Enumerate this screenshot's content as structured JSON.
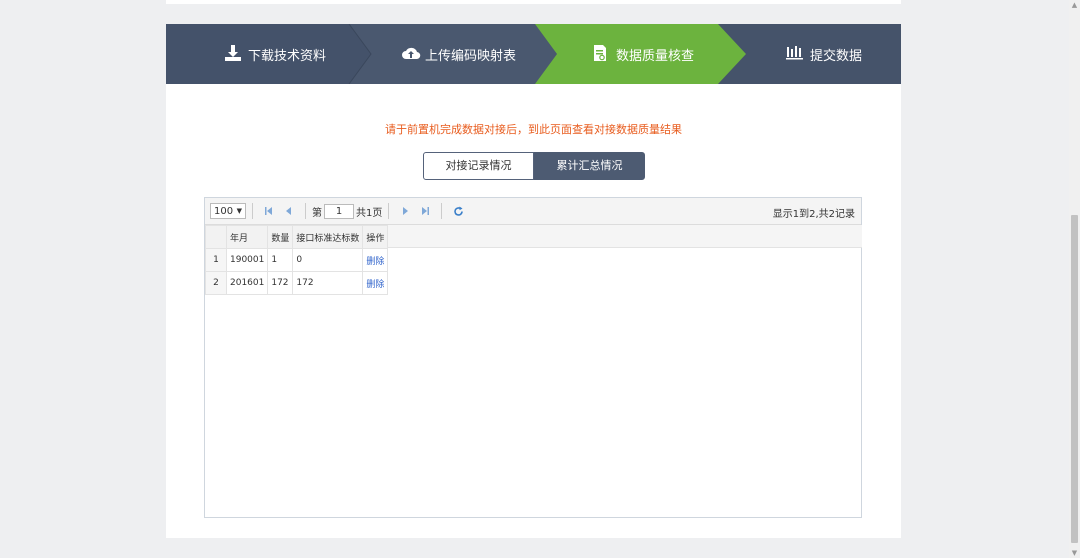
{
  "steps": [
    {
      "label": "下载技术资料",
      "icon": "download-icon"
    },
    {
      "label": "上传编码映射表",
      "icon": "cloud-upload-icon"
    },
    {
      "label": "数据质量核查",
      "icon": "document-check-icon"
    },
    {
      "label": "提交数据",
      "icon": "bar-chart-icon"
    }
  ],
  "active_step": 2,
  "colors": {
    "step_bg": "#45536a",
    "step_active": "#6cb33e",
    "notice": "#e85c1e",
    "link": "#3366cc"
  },
  "notice": "请于前置机完成数据对接后，到此页面查看对接数据质量结果",
  "tabs": [
    {
      "label": "对接记录情况",
      "active": false
    },
    {
      "label": "累计汇总情况",
      "active": true
    }
  ],
  "grid": {
    "page_size": "100",
    "page_label": "第",
    "page_value": "1",
    "total_pages": "共1页",
    "info": "显示1到2,共2记录",
    "columns": [
      "年月",
      "数量",
      "接口标准达标数",
      "操作"
    ],
    "rows": [
      {
        "index": "1",
        "month": "190001",
        "count": "1",
        "compliant": "0",
        "action": "删除"
      },
      {
        "index": "2",
        "month": "201601",
        "count": "172",
        "compliant": "172",
        "action": "删除"
      }
    ]
  }
}
